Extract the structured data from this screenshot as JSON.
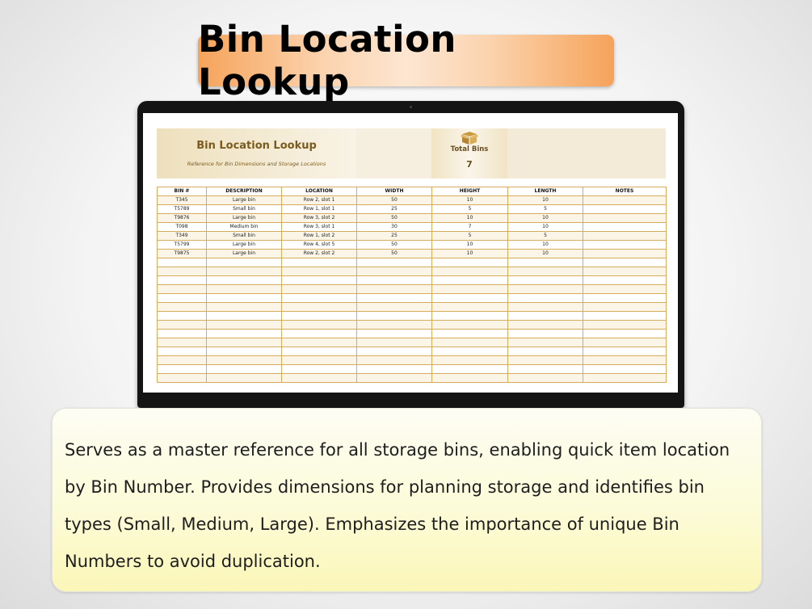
{
  "page_title": "Bin Location Lookup",
  "sheet": {
    "title": "Bin Location Lookup",
    "subtitle": "Reference for Bin Dimensions and Storage Locations",
    "total_label": "Total Bins",
    "total_value": "7",
    "columns": [
      "BIN #",
      "DESCRIPTION",
      "LOCATION",
      "WIDTH",
      "HEIGHT",
      "LENGTH",
      "NOTES"
    ],
    "rows": [
      [
        "T345",
        "Large bin",
        "Row 2, slot 1",
        "50",
        "10",
        "10",
        ""
      ],
      [
        "T5789",
        "Small bin",
        "Row 1, slot 1",
        "25",
        "5",
        "5",
        ""
      ],
      [
        "T9876",
        "Large bin",
        "Row 3, slot 2",
        "50",
        "10",
        "10",
        ""
      ],
      [
        "T098",
        "Medium bin",
        "Row 3, slot 1",
        "30",
        "7",
        "10",
        ""
      ],
      [
        "T349",
        "Small bin",
        "Row 1, slot 2",
        "25",
        "5",
        "5",
        ""
      ],
      [
        "T5799",
        "Large bin",
        "Row 4, slot 5",
        "50",
        "10",
        "10",
        ""
      ],
      [
        "T9875",
        "Large bin",
        "Row 2, slot 2",
        "50",
        "10",
        "10",
        ""
      ]
    ],
    "empty_row_count": 14,
    "accent_color": "#d6ab5c",
    "title_color": "#7a5b1e"
  },
  "description": "Serves as a master reference for all storage bins, enabling quick item location\nby Bin Number.  Provides dimensions for planning storage and identifies bin\ntypes (Small, Medium, Large). Emphasizes the importance of unique Bin\nNumbers to avoid duplication.",
  "icons": {
    "total_bins": "box-icon"
  }
}
